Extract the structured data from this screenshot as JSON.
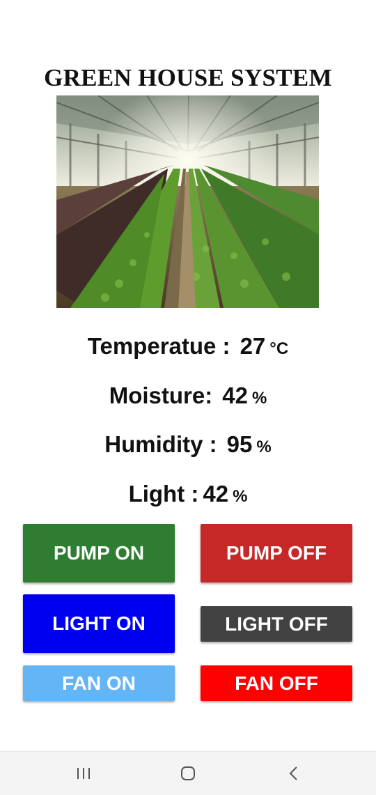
{
  "app": {
    "title": "GREEN HOUSE SYSTEM"
  },
  "image": {
    "name": "greenhouse-photo",
    "description_hidden": true
  },
  "readings": {
    "temperature": {
      "label": "Temperatue :",
      "value": "27",
      "unit": "°C"
    },
    "moisture": {
      "label": "Moisture:",
      "value": "42",
      "unit": "%"
    },
    "humidity": {
      "label": "Humidity :",
      "value": "95",
      "unit": "%"
    },
    "light": {
      "label": "Light :",
      "value": "42",
      "unit": "%"
    }
  },
  "buttons": {
    "pump_on": {
      "label": "PUMP ON",
      "color": "#2e7d32"
    },
    "pump_off": {
      "label": "PUMP OFF",
      "color": "#c62828"
    },
    "light_on": {
      "label": "LIGHT ON",
      "color": "#0000f0"
    },
    "light_off": {
      "label": "LIGHT OFF",
      "color": "#424242"
    },
    "fan_on": {
      "label": "FAN ON",
      "color": "#64b5f6"
    },
    "fan_off": {
      "label": "FAN OFF",
      "color": "#ff0000"
    }
  },
  "navbar": {
    "icons": [
      "recents-icon",
      "home-icon",
      "back-icon"
    ]
  }
}
